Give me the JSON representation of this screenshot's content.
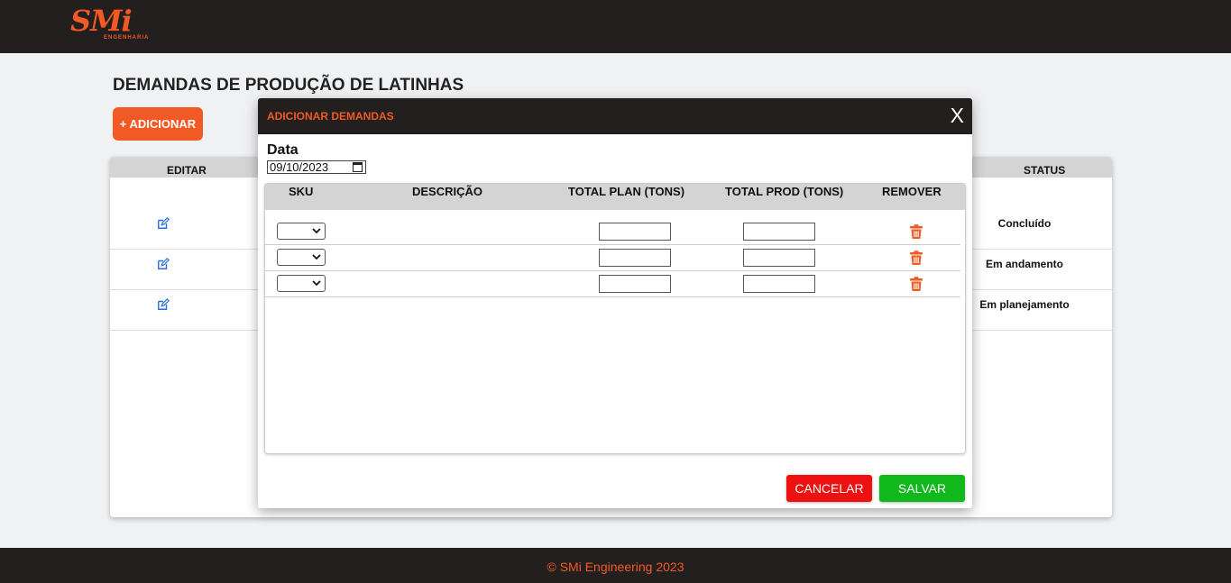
{
  "header": {
    "logo_text": "SMi",
    "logo_subtext": "ENGENHARIA",
    "brand_color": "#f15a24",
    "bar_color": "#231f1e"
  },
  "page": {
    "title": "DEMANDAS DE PRODUÇÃO DE LATINHAS",
    "add_button_label": "+ ADICIONAR"
  },
  "table": {
    "columns": {
      "editar": "EDITAR",
      "status": "STATUS"
    },
    "rows": [
      {
        "status": "Concluído",
        "edit_icon": "edit-icon"
      },
      {
        "status": "Em andamento",
        "edit_icon": "edit-icon"
      },
      {
        "status": "Em planejamento",
        "edit_icon": "edit-icon"
      }
    ]
  },
  "modal": {
    "title": "ADICIONAR DEMANDAS",
    "close_label": "X",
    "date_label": "Data",
    "date_value": "09/10/2023",
    "columns": {
      "sku": "SKU",
      "descricao": "DESCRIÇÃO",
      "total_plan": "TOTAL PLAN (TONS)",
      "total_prod": "TOTAL PROD (TONS)",
      "remover": "REMOVER"
    },
    "items": [
      {
        "sku": "",
        "descricao": "",
        "total_plan": "",
        "total_prod": "",
        "remove_icon": "trash-icon"
      },
      {
        "sku": "",
        "descricao": "",
        "total_plan": "",
        "total_prod": "",
        "remove_icon": "trash-icon"
      },
      {
        "sku": "",
        "descricao": "",
        "total_plan": "",
        "total_prod": "",
        "remove_icon": "trash-icon"
      }
    ],
    "cancel_label": "CANCELAR",
    "save_label": "SALVAR",
    "cancel_color": "#ee1111",
    "save_color": "#10b81c"
  },
  "footer": {
    "text": "© SMi Engineering 2023"
  }
}
